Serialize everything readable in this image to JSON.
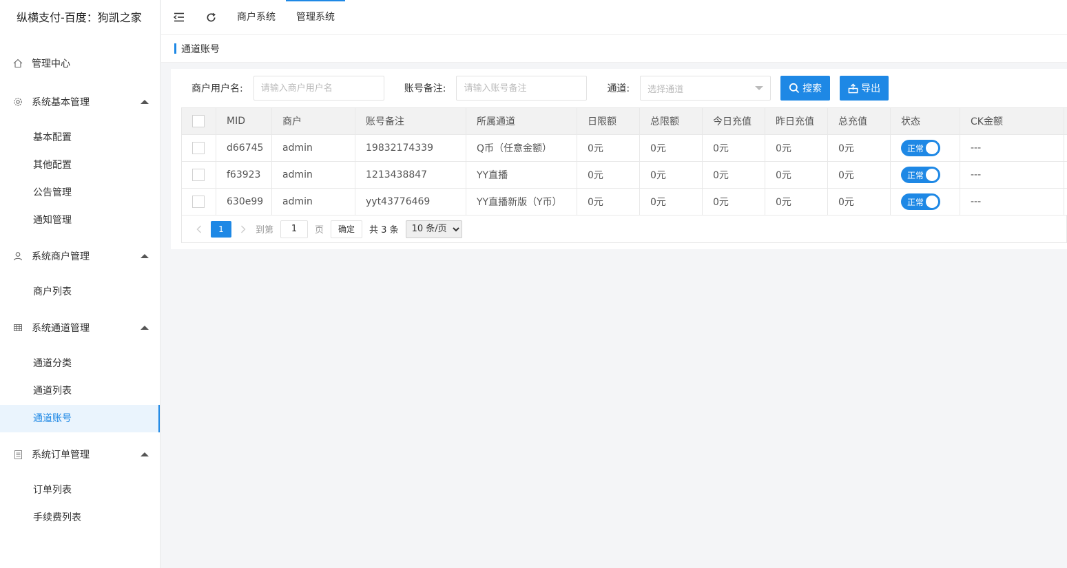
{
  "app": {
    "title": "纵横支付-百度：狗凯之家"
  },
  "sidebar": {
    "groups": [
      {
        "label": "管理中心",
        "icon": "home-icon",
        "items": []
      },
      {
        "label": "系统基本管理",
        "icon": "gear-icon",
        "items": [
          "基本配置",
          "其他配置",
          "公告管理",
          "通知管理"
        ]
      },
      {
        "label": "系统商户管理",
        "icon": "user-icon",
        "items": [
          "商户列表"
        ]
      },
      {
        "label": "系统通道管理",
        "icon": "grid-icon",
        "items": [
          "通道分类",
          "通道列表",
          "通道账号"
        ]
      },
      {
        "label": "系统订单管理",
        "icon": "document-icon",
        "items": [
          "订单列表",
          "手续费列表"
        ]
      }
    ],
    "active_item": "通道账号"
  },
  "header": {
    "nav": [
      "商户系统",
      "管理系统"
    ],
    "active_nav": "管理系统"
  },
  "breadcrumb": {
    "current": "通道账号"
  },
  "filters": {
    "merchant_label": "商户用户名:",
    "merchant_placeholder": "请输入商户用户名",
    "remark_label": "账号备注:",
    "remark_placeholder": "请输入账号备注",
    "channel_label": "通道:",
    "channel_placeholder": "选择通道",
    "search_button": "搜索",
    "export_button": "导出"
  },
  "table": {
    "columns": [
      "MID",
      "商户",
      "账号备注",
      "所属通道",
      "日限额",
      "总限额",
      "今日充值",
      "昨日充值",
      "总充值",
      "状态",
      "CK金额"
    ],
    "rows": [
      {
        "mid": "d66745",
        "merchant": "admin",
        "remark": "19832174339",
        "channel": "Q币（任意金额）",
        "daily_limit": "0元",
        "total_limit": "0元",
        "today": "0元",
        "yesterday": "0元",
        "total": "0元",
        "status": "正常",
        "ck": "---"
      },
      {
        "mid": "f63923",
        "merchant": "admin",
        "remark": "1213438847",
        "channel": "YY直播",
        "daily_limit": "0元",
        "total_limit": "0元",
        "today": "0元",
        "yesterday": "0元",
        "total": "0元",
        "status": "正常",
        "ck": "---"
      },
      {
        "mid": "630e99",
        "merchant": "admin",
        "remark": "yyt43776469",
        "channel": "YY直播新版（Y币）",
        "daily_limit": "0元",
        "total_limit": "0元",
        "today": "0元",
        "yesterday": "0元",
        "total": "0元",
        "status": "正常",
        "ck": "---"
      }
    ]
  },
  "pagination": {
    "current": "1",
    "goto_label": "到第",
    "goto_value": "1",
    "page_unit": "页",
    "confirm": "确定",
    "total": "共 3 条",
    "page_size": "10 条/页"
  },
  "colors": {
    "accent": "#1e88e5"
  }
}
